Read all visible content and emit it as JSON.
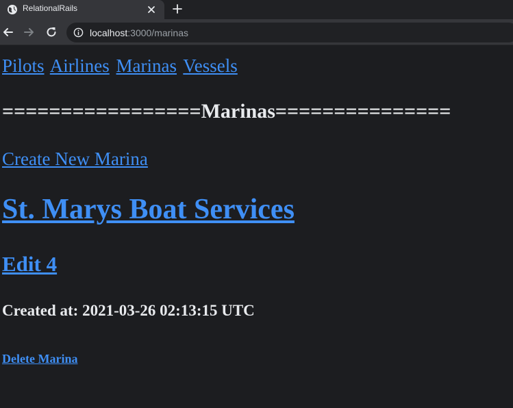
{
  "browser": {
    "tab_title": "RelationalRails",
    "url_host": "localhost",
    "url_rest": ":3000/marinas"
  },
  "nav": {
    "links": [
      "Pilots",
      "Airlines",
      "Marinas",
      "Vessels"
    ]
  },
  "heading": "=================Marinas===============",
  "create_link": "Create New Marina",
  "marina": {
    "name": "St. Marys Boat Services",
    "edit_label": "Edit 4",
    "created_at": "Created at: 2021-03-26 02:13:15 UTC",
    "delete_label": "Delete Marina"
  },
  "colors": {
    "link": "#3f8ff5",
    "background": "#1c1d20",
    "text": "#e8eaed"
  },
  "icons": [
    "globe-icon",
    "close-icon",
    "plus-icon",
    "back-arrow-icon",
    "forward-arrow-icon",
    "reload-icon",
    "info-icon"
  ]
}
